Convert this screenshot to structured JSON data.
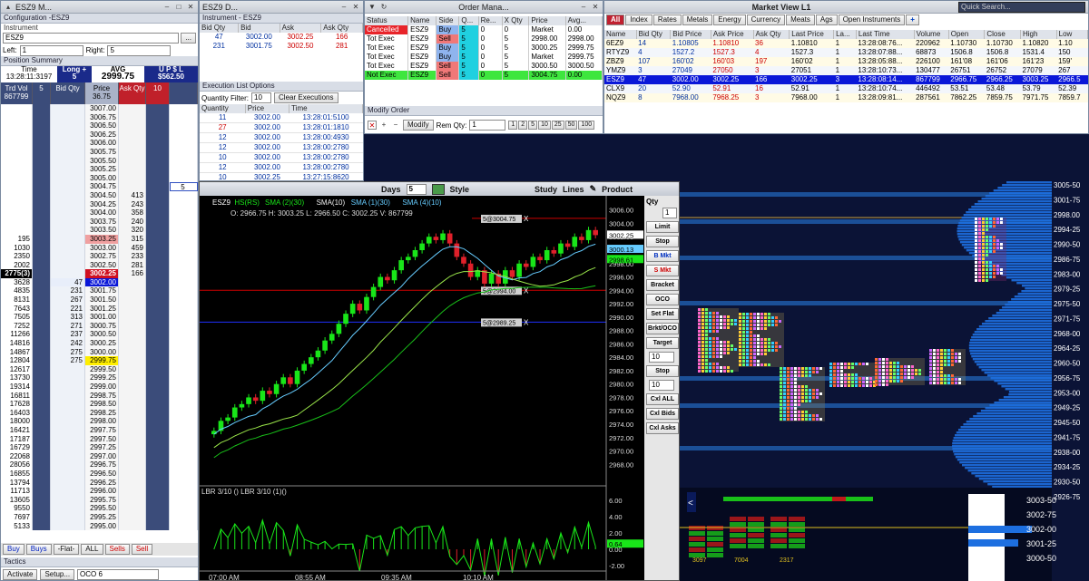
{
  "ladder": {
    "title": "ESZ9 M...",
    "config_label": "Configuration -ESZ9",
    "instrument_label": "Instrument",
    "instrument": "ESZ9",
    "left_label": "Left:",
    "left_value": "1",
    "right_label": "Right:",
    "right_value": "5",
    "position_summary_label": "Position Summary",
    "time_label": "Time",
    "time_value": "13:28:11:3197",
    "position_label": "Long +",
    "position_value": "5",
    "avg_label": "AVG",
    "avg_value": "2999.75",
    "upsl_label": "U P $ L",
    "upsl_value": "$562.50",
    "col_trd_vol": "Trd Vol",
    "trd_vol_value": "867799",
    "col_left": "5",
    "col_bid": "Bid Qty",
    "col_price": "Price",
    "price_top": "36.75",
    "col_ask": "Ask Qty",
    "col_right": "10",
    "rows": [
      {
        "v": "",
        "b": "",
        "p": "3007.00",
        "a": ""
      },
      {
        "v": "",
        "b": "",
        "p": "3006.75",
        "a": ""
      },
      {
        "v": "",
        "b": "",
        "p": "3006.50",
        "a": ""
      },
      {
        "v": "",
        "b": "",
        "p": "3006.25",
        "a": ""
      },
      {
        "v": "",
        "b": "",
        "p": "3006.00",
        "a": ""
      },
      {
        "v": "",
        "b": "",
        "p": "3005.75",
        "a": ""
      },
      {
        "v": "",
        "b": "",
        "p": "3005.50",
        "a": ""
      },
      {
        "v": "",
        "b": "",
        "p": "3005.25",
        "a": ""
      },
      {
        "v": "",
        "b": "",
        "p": "3005.00",
        "a": ""
      },
      {
        "v": "",
        "b": "",
        "p": "3004.75",
        "a": ""
      },
      {
        "v": "",
        "b": "",
        "p": "3004.50",
        "a": "413"
      },
      {
        "v": "",
        "b": "",
        "p": "3004.25",
        "a": "243"
      },
      {
        "v": "",
        "b": "",
        "p": "3004.00",
        "a": "358"
      },
      {
        "v": "",
        "b": "",
        "p": "3003.75",
        "a": "240"
      },
      {
        "v": "",
        "b": "",
        "p": "3003.50",
        "a": "320"
      },
      {
        "v": "195",
        "b": "",
        "p": "3003.25",
        "a": "315"
      },
      {
        "v": "1030",
        "b": "",
        "p": "3003.00",
        "a": "459"
      },
      {
        "v": "2350",
        "b": "",
        "p": "3002.75",
        "a": "233"
      },
      {
        "v": "2002",
        "b": "",
        "p": "3002.50",
        "a": "281"
      },
      {
        "v": "2775(3)",
        "b": "",
        "p": "3002.25",
        "a": "166"
      },
      {
        "v": "3628",
        "b": "47",
        "p": "3002.00",
        "a": ""
      },
      {
        "v": "4835",
        "b": "231",
        "p": "3001.75",
        "a": ""
      },
      {
        "v": "8131",
        "b": "267",
        "p": "3001.50",
        "a": ""
      },
      {
        "v": "7643",
        "b": "221",
        "p": "3001.25",
        "a": ""
      },
      {
        "v": "7505",
        "b": "313",
        "p": "3001.00",
        "a": ""
      },
      {
        "v": "7252",
        "b": "271",
        "p": "3000.75",
        "a": ""
      },
      {
        "v": "11266",
        "b": "237",
        "p": "3000.50",
        "a": ""
      },
      {
        "v": "14816",
        "b": "242",
        "p": "3000.25",
        "a": ""
      },
      {
        "v": "14867",
        "b": "275",
        "p": "3000.00",
        "a": ""
      },
      {
        "v": "12804",
        "b": "275",
        "p": "2999.75",
        "a": ""
      },
      {
        "v": "12617",
        "b": "",
        "p": "2999.50",
        "a": ""
      },
      {
        "v": "13730",
        "b": "",
        "p": "2999.25",
        "a": ""
      },
      {
        "v": "19314",
        "b": "",
        "p": "2999.00",
        "a": ""
      },
      {
        "v": "16811",
        "b": "",
        "p": "2998.75",
        "a": ""
      },
      {
        "v": "17628",
        "b": "",
        "p": "2998.50",
        "a": ""
      },
      {
        "v": "16403",
        "b": "",
        "p": "2998.25",
        "a": ""
      },
      {
        "v": "18000",
        "b": "",
        "p": "2998.00",
        "a": ""
      },
      {
        "v": "16421",
        "b": "",
        "p": "2997.75",
        "a": ""
      },
      {
        "v": "17187",
        "b": "",
        "p": "2997.50",
        "a": ""
      },
      {
        "v": "16729",
        "b": "",
        "p": "2997.25",
        "a": ""
      },
      {
        "v": "22068",
        "b": "",
        "p": "2997.00",
        "a": ""
      },
      {
        "v": "28056",
        "b": "",
        "p": "2996.75",
        "a": ""
      },
      {
        "v": "16855",
        "b": "",
        "p": "2996.50",
        "a": ""
      },
      {
        "v": "13794",
        "b": "",
        "p": "2996.25",
        "a": ""
      },
      {
        "v": "11713",
        "b": "",
        "p": "2996.00",
        "a": ""
      },
      {
        "v": "13605",
        "b": "",
        "p": "2995.75",
        "a": ""
      },
      {
        "v": "9550",
        "b": "",
        "p": "2995.50",
        "a": ""
      },
      {
        "v": "7697",
        "b": "",
        "p": "2995.25",
        "a": ""
      },
      {
        "v": "5133",
        "b": "",
        "p": "2995.00",
        "a": ""
      }
    ],
    "buy_label": "Buy",
    "buys_label": "Buys",
    "flat_label": "-Flat-",
    "all_label": "ALL",
    "sells_label": "Sells",
    "sell_label": "Sell",
    "tactics_label": "Tactics",
    "activate_label": "Activate",
    "setup_label": "Setup...",
    "oco_label": "OCO 6"
  },
  "inst_win": {
    "title": "ESZ9 D...",
    "instrument_label": "Instrument - ESZ9",
    "headers": [
      "Bid Qty",
      "Bid",
      "Ask",
      "Ask Qty"
    ],
    "rows": [
      [
        "47",
        "3002.00",
        "3002.25",
        "166"
      ],
      [
        "231",
        "3001.75",
        "3002.50",
        "281"
      ]
    ],
    "exec_label": "Execution List Options",
    "qty_filter_label": "Quantity Filter:",
    "qty_filter_value": "10",
    "clear_label": "Clear Executions",
    "exec_headers": [
      "Quantity",
      "Price",
      "Time"
    ],
    "exec_rows": [
      [
        "11",
        "3002.00",
        "13:28:01:5100"
      ],
      [
        "27",
        "3002.00",
        "13:28:01:1810"
      ],
      [
        "12",
        "3002.00",
        "13:28:00:4930"
      ],
      [
        "12",
        "3002.00",
        "13:28:00:2780"
      ],
      [
        "10",
        "3002.00",
        "13:28:00:2780"
      ],
      [
        "12",
        "3002.00",
        "13:28:00:2780"
      ],
      [
        "10",
        "3002.25",
        "13:27:15:8620"
      ],
      [
        "10",
        "3002.25",
        "13:27:07:2500"
      ]
    ]
  },
  "order_win": {
    "title": "Order Mana...",
    "headers": [
      "Status",
      "Name",
      "Side",
      "Q...",
      "Re...",
      "X Qty",
      "Price",
      "Avg..."
    ],
    "rows": [
      {
        "cells": [
          "Cancelled",
          "ESZ9",
          "Buy",
          "5",
          "0",
          "0",
          "Market",
          "0.00"
        ],
        "kind": "cancel"
      },
      {
        "cells": [
          "Tot Exec",
          "ESZ9",
          "Sell",
          "5",
          "0",
          "5",
          "2998.00",
          "2998.00"
        ],
        "kind": "sell"
      },
      {
        "cells": [
          "Tot Exec",
          "ESZ9",
          "Buy",
          "5",
          "0",
          "5",
          "3000.25",
          "2999.75"
        ],
        "kind": "buy"
      },
      {
        "cells": [
          "Tot Exec",
          "ESZ9",
          "Buy",
          "5",
          "0",
          "5",
          "Market",
          "2999.75"
        ],
        "kind": "buy"
      },
      {
        "cells": [
          "Tot Exec",
          "ESZ9",
          "Sell",
          "5",
          "0",
          "5",
          "3000.50",
          "3000.50"
        ],
        "kind": "sell"
      },
      {
        "cells": [
          "Not Exec",
          "ESZ9",
          "Sell",
          "5",
          "0",
          "5",
          "3004.75",
          "0.00"
        ],
        "kind": "notexec"
      }
    ],
    "modify_section": "Modify Order",
    "modify_label": "Modify",
    "rem_qty_label": "Rem Qty:",
    "rem_qty_value": "1",
    "qty_buttons": [
      "1",
      "2",
      "5",
      "10",
      "25",
      "50",
      "100"
    ]
  },
  "market_win": {
    "title": "Market View L1",
    "search_placeholder": "Quick Search...",
    "tabs": [
      "All",
      "Index",
      "Rates",
      "Metals",
      "Energy",
      "Currency",
      "Meats",
      "Ags",
      "Open Instruments"
    ],
    "headers": [
      "Name",
      "Bid Qty",
      "Bid Price",
      "Ask Price",
      "Ask Qty",
      "Last Price",
      "La...",
      "Last Time",
      "Volume",
      "Open",
      "Close",
      "High",
      "Low"
    ],
    "rows": [
      {
        "cells": [
          "6EZ9",
          "14",
          "1.10805",
          "1.10810",
          "36",
          "1.10810",
          "1",
          "13:28:08:76...",
          "220962",
          "1.10730",
          "1.10730",
          "1.10820",
          "1.10"
        ],
        "sel": false
      },
      {
        "cells": [
          "RTYZ9",
          "4",
          "1527.2",
          "1527.3",
          "4",
          "1527.3",
          "1",
          "13:28:07:88...",
          "68873",
          "1506.8",
          "1506.8",
          "1531.4",
          "150"
        ],
        "sel": false
      },
      {
        "cells": [
          "ZBZ9",
          "107",
          "160'02",
          "160'03",
          "197",
          "160'02",
          "1",
          "13:28:05:88...",
          "226100",
          "161'08",
          "161'06",
          "161'23",
          "159'"
        ],
        "sel": false
      },
      {
        "cells": [
          "YMZ9",
          "3",
          "27049",
          "27050",
          "3",
          "27051",
          "1",
          "13:28:10:73...",
          "130477",
          "26751",
          "26752",
          "27079",
          "267"
        ],
        "sel": false
      },
      {
        "cells": [
          "ESZ9",
          "47",
          "3002.00",
          "3002.25",
          "166",
          "3002.25",
          "3",
          "13:28:08:14...",
          "867799",
          "2966.75",
          "2966.25",
          "3003.25",
          "2966.5"
        ],
        "sel": true
      },
      {
        "cells": [
          "CLX9",
          "20",
          "52.90",
          "52.91",
          "16",
          "52.91",
          "1",
          "13:28:10:74...",
          "446492",
          "53.51",
          "53.48",
          "53.79",
          "52.39"
        ],
        "sel": false
      },
      {
        "cells": [
          "NQZ9",
          "8",
          "7968.00",
          "7968.25",
          "3",
          "7968.00",
          "1",
          "13:28:09:81...",
          "287561",
          "7862.25",
          "7859.75",
          "7971.75",
          "7859.7"
        ],
        "sel": false
      }
    ]
  },
  "chart": {
    "symbol": "ESZ9",
    "days_label": "Days",
    "days_value": "5",
    "style_label": "Style",
    "study_label": "Study",
    "lines_label": "Lines",
    "product_label": "Product",
    "legend": [
      "ESZ9",
      "HS(RS)",
      "SMA (2)(30)",
      "SMA(10)",
      "SMA (1)(30)",
      "SMA (4)(10)"
    ],
    "ohlc": "O: 2966.75 H: 3003.25 L: 2966.50 C: 3002.25 V: 867799",
    "order_label_top": "5@3004.75",
    "order_label_mid": "5@2994.00",
    "order_label_low": "5@2989.25",
    "price_ticks": [
      "3006.00",
      "3004.00",
      "3002.00",
      "3000.00",
      "2998.00",
      "2996.00",
      "2994.00",
      "2992.00",
      "2990.00",
      "2988.00",
      "2986.00",
      "2984.00",
      "2982.00",
      "2980.00",
      "2978.00",
      "2976.00",
      "2974.00",
      "2972.00",
      "2970.00",
      "2968.00"
    ],
    "last_price_tags": [
      "3002.25",
      "3000.13",
      "2998.61"
    ],
    "lower_label": "LBR 3/10 () LBR 3/10  (1)()",
    "lower_ticks": [
      "6.00",
      "4.00",
      "2.00",
      "0.00",
      "-2.00"
    ],
    "lower_tag": "0.64",
    "time_ticks": [
      "07:00 AM",
      "08:55 AM",
      "09:35 AM",
      "10:10 AM"
    ],
    "side_qty_label": "Qty",
    "side_qty_value": "1",
    "side_buttons": [
      "Limit",
      "Stop",
      "B Mkt",
      "S Mkt",
      "Bracket",
      "OCO",
      "Set Flat",
      "Brkt/OCO",
      "Target",
      "Stop",
      "Cxl ALL",
      "Cxl Bids",
      "Cxl Asks"
    ],
    "side_target_value": "10",
    "side_stop_value": "10"
  },
  "profile": {
    "price_ticks": [
      "3005-50",
      "3001-75",
      "2998.00",
      "2994-25",
      "2990-50",
      "2986-75",
      "2983-00",
      "2979-25",
      "2975-50",
      "2971-75",
      "2968-00",
      "2964-25",
      "2960-50",
      "2956-75",
      "2953-00",
      "2949-25",
      "2945-50",
      "2941-75",
      "2938-00",
      "2934-25",
      "2930-50",
      "2926-75"
    ],
    "lower_ticks": [
      "3003-50",
      "3002-75",
      "3002-00",
      "3001-25",
      "3000-50"
    ],
    "lower_counts": [
      "3097",
      "7004",
      "2317"
    ]
  },
  "colors": {
    "bull": "#19e619",
    "bear": "#e0202a",
    "select": "#0a17d8"
  }
}
